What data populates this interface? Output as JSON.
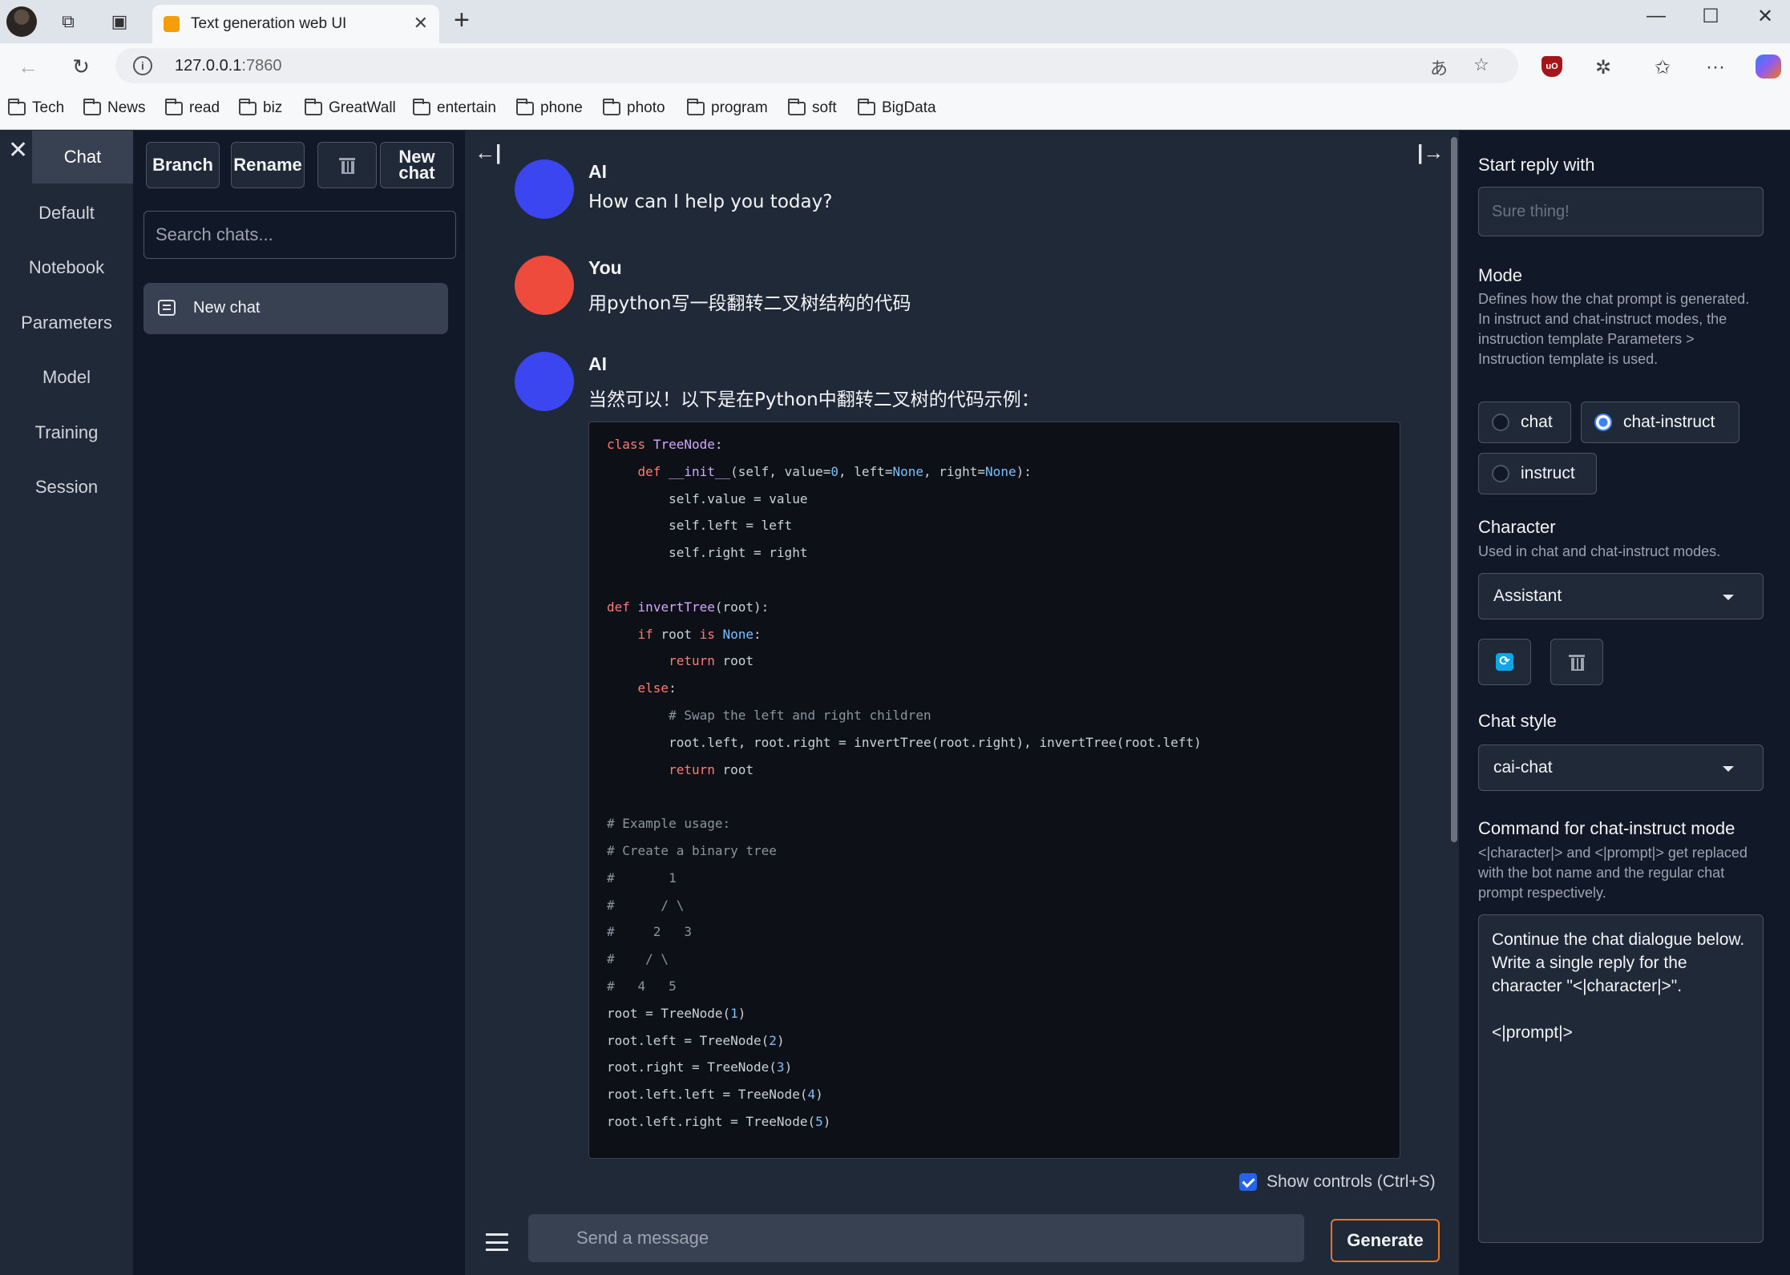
{
  "browser": {
    "tab_title": "Text generation web UI",
    "url_host": "127.0.0.1",
    "url_port": ":7860",
    "bookmarks": [
      "Tech",
      "News",
      "read",
      "biz",
      "GreatWall",
      "entertain",
      "phone",
      "photo",
      "program",
      "soft",
      "BigData"
    ]
  },
  "nav": {
    "items": [
      "Chat",
      "Default",
      "Notebook",
      "Parameters",
      "Model",
      "Training",
      "Session"
    ],
    "active": "Chat"
  },
  "chatlist": {
    "branch_label": "Branch",
    "rename_label": "Rename",
    "new_chat_label": "New\nchat",
    "search_placeholder": "Search chats...",
    "items": [
      {
        "label": "New chat"
      }
    ]
  },
  "messages": [
    {
      "sender": "AI",
      "text": "How can I help you today?",
      "avatar_color": "#3b45f0"
    },
    {
      "sender": "You",
      "text": "用python写一段翻转二叉树结构的代码",
      "avatar_color": "#ef4b3c"
    },
    {
      "sender": "AI",
      "text": "当然可以！以下是在Python中翻转二叉树的代码示例：",
      "avatar_color": "#3b45f0"
    }
  ],
  "code_lines": [
    "class TreeNode:",
    "    def __init__(self, value=0, left=None, right=None):",
    "        self.value = value",
    "        self.left = left",
    "        self.right = right",
    "",
    "def invertTree(root):",
    "    if root is None:",
    "        return root",
    "    else:",
    "        # Swap the left and right children",
    "        root.left, root.right = invertTree(root.right), invertTree(root.left)",
    "        return root",
    "",
    "# Example usage:",
    "# Create a binary tree",
    "#       1",
    "#      / \\",
    "#     2   3",
    "#    / \\",
    "#   4   5",
    "root = TreeNode(1)",
    "root.left = TreeNode(2)",
    "root.right = TreeNode(3)",
    "root.left.left = TreeNode(4)",
    "root.left.right = TreeNode(5)"
  ],
  "composer": {
    "show_controls_label": "Show controls (Ctrl+S)",
    "show_controls_checked": true,
    "message_placeholder": "Send a message",
    "generate_label": "Generate"
  },
  "right_panel": {
    "start_reply_label": "Start reply with",
    "start_reply_placeholder": "Sure thing!",
    "mode_label": "Mode",
    "mode_desc": "Defines how the chat prompt is generated. In instruct and chat-instruct modes, the instruction template Parameters > Instruction template is used.",
    "mode_options": [
      "chat",
      "chat-instruct",
      "instruct"
    ],
    "mode_selected": "chat-instruct",
    "character_label": "Character",
    "character_desc": "Used in chat and chat-instruct modes.",
    "character_value": "Assistant",
    "chat_style_label": "Chat style",
    "chat_style_value": "cai-chat",
    "command_label": "Command for chat-instruct mode",
    "command_desc": "<|character|> and <|prompt|> get replaced with the bot name and the regular chat prompt respectively.",
    "command_value": "Continue the chat dialogue below. Write a single reply for the character \"<|character|>\".\n\n<|prompt|>"
  }
}
